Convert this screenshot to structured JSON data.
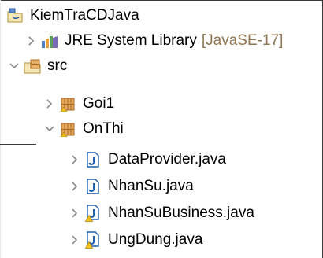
{
  "tree": {
    "project": {
      "label": "KiemTraCDJava",
      "icon": "java-project-icon"
    },
    "jre": {
      "label": "JRE System Library",
      "suffix": "[JavaSE-17]",
      "icon": "library-icon",
      "expanded": false
    },
    "src": {
      "label": "src",
      "icon": "source-folder-icon",
      "expanded": true
    },
    "packages": [
      {
        "label": "Goi1",
        "icon": "package-icon",
        "expanded": false
      },
      {
        "label": "OnThi",
        "icon": "package-icon",
        "expanded": true
      }
    ],
    "files": [
      {
        "label": "DataProvider.java",
        "icon": "java-file-icon",
        "has_warning": false
      },
      {
        "label": "NhanSu.java",
        "icon": "java-file-icon",
        "has_warning": false
      },
      {
        "label": "NhanSuBusiness.java",
        "icon": "java-file-warning-icon",
        "has_warning": true
      },
      {
        "label": "UngDung.java",
        "icon": "java-file-warning-icon",
        "has_warning": true
      }
    ]
  },
  "colors": {
    "chevron": "#8a8a8a",
    "decorator_label": "#8f7652",
    "java_blue": "#1f5fae",
    "warning_yellow": "#f2c21b",
    "package_brown": "#a86a22"
  }
}
